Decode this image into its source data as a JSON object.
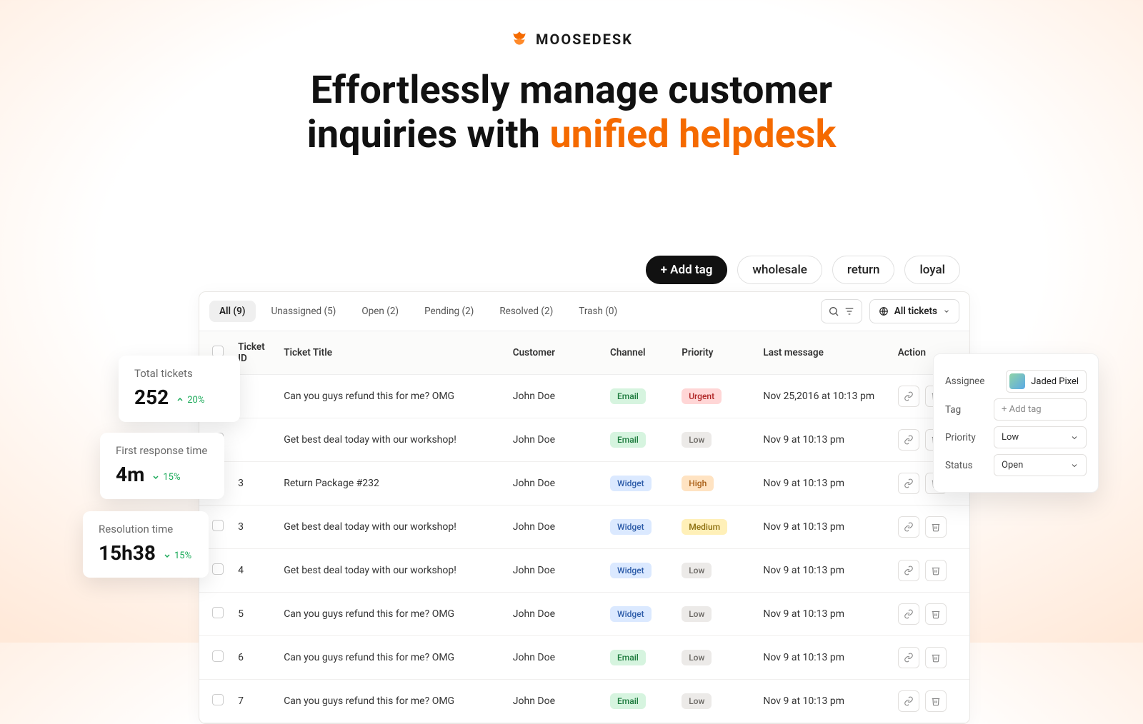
{
  "brand": {
    "name": "MOOSEDESK"
  },
  "headline": {
    "line1": "Effortlessly manage customer",
    "line2_a": "inquiries with ",
    "line2_b": "unified helpdesk"
  },
  "tagbar": {
    "add": "+ Add tag",
    "tags": [
      "wholesale",
      "return",
      "loyal"
    ]
  },
  "tabs": [
    {
      "label": "All (9)",
      "active": true
    },
    {
      "label": "Unassigned (5)",
      "active": false
    },
    {
      "label": "Open (2)",
      "active": false
    },
    {
      "label": "Pending (2)",
      "active": false
    },
    {
      "label": "Resolved (2)",
      "active": false
    },
    {
      "label": "Trash (0)",
      "active": false
    }
  ],
  "view_btn": "All tickets",
  "cols": {
    "id": "Ticket ID",
    "title": "Ticket Title",
    "customer": "Customer",
    "channel": "Channel",
    "priority": "Priority",
    "last": "Last message",
    "action": "Action"
  },
  "rows": [
    {
      "id": "",
      "title": "Can you guys refund this for me? OMG",
      "customer": "John Doe",
      "channel": "Email",
      "priority": "Urgent",
      "last": "Nov 25,2016 at 10:13 pm"
    },
    {
      "id": "",
      "title": "Get best deal today with our workshop!",
      "customer": "John Doe",
      "channel": "Email",
      "priority": "Low",
      "last": "Nov 9 at 10:13 pm"
    },
    {
      "id": "3",
      "title": "Return Package #232",
      "customer": "John Doe",
      "channel": "Widget",
      "priority": "High",
      "last": "Nov 9 at 10:13 pm"
    },
    {
      "id": "3",
      "title": "Get best deal today with our workshop!",
      "customer": "John Doe",
      "channel": "Widget",
      "priority": "Medium",
      "last": "Nov 9 at 10:13 pm"
    },
    {
      "id": "4",
      "title": "Get best deal today with our workshop!",
      "customer": "John Doe",
      "channel": "Widget",
      "priority": "Low",
      "last": "Nov 9 at 10:13 pm"
    },
    {
      "id": "5",
      "title": "Can you guys refund this for me? OMG",
      "customer": "John Doe",
      "channel": "Widget",
      "priority": "Low",
      "last": "Nov 9 at 10:13 pm"
    },
    {
      "id": "6",
      "title": "Can you guys refund this for me? OMG",
      "customer": "John Doe",
      "channel": "Email",
      "priority": "Low",
      "last": "Nov 9 at 10:13 pm"
    },
    {
      "id": "7",
      "title": "Can you guys refund this for me? OMG",
      "customer": "John Doe",
      "channel": "Email",
      "priority": "Low",
      "last": "Nov 9 at 10:13 pm"
    }
  ],
  "kpis": [
    {
      "label": "Total tickets",
      "value": "252",
      "delta": "20%",
      "dir": "up"
    },
    {
      "label": "First response time",
      "value": "4m",
      "delta": "15%",
      "dir": "down"
    },
    {
      "label": "Resolution time",
      "value": "15h38",
      "delta": "15%",
      "dir": "down"
    }
  ],
  "side": {
    "assignee_label": "Assignee",
    "assignee_value": "Jaded Pixel",
    "tag_label": "Tag",
    "tag_placeholder": "+ Add tag",
    "priority_label": "Priority",
    "priority_value": "Low",
    "status_label": "Status",
    "status_value": "Open"
  },
  "colors": {
    "accent": "#f56a00",
    "pos": "#18a957"
  }
}
